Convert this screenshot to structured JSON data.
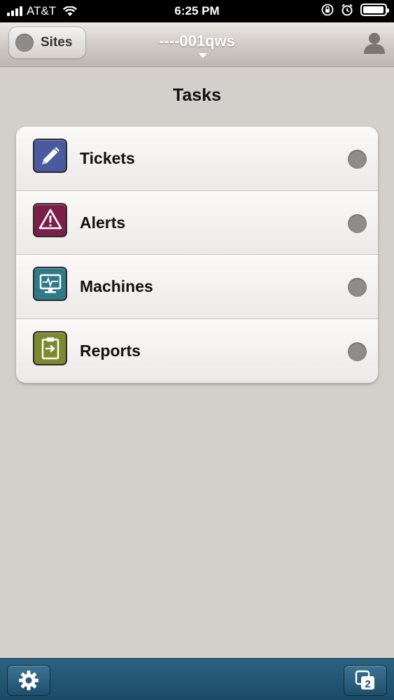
{
  "status_bar": {
    "carrier": "AT&T",
    "time": "6:25 PM",
    "battery_level": 0.95
  },
  "nav": {
    "sites_label": "Sites",
    "title": "----001qws",
    "user_icon": "user-icon"
  },
  "page": {
    "title": "Tasks"
  },
  "tasks": [
    {
      "label": "Tickets",
      "icon": "pencil-icon",
      "color": "#4a5a9e"
    },
    {
      "label": "Alerts",
      "icon": "warning-icon",
      "color": "#7a1f4a"
    },
    {
      "label": "Machines",
      "icon": "monitor-icon",
      "color": "#2f7a86"
    },
    {
      "label": "Reports",
      "icon": "clipboard-icon",
      "color": "#7c8a2e"
    }
  ],
  "toolbar": {
    "settings_icon": "gear-icon",
    "windows_icon": "windows-icon",
    "windows_count": "2"
  }
}
